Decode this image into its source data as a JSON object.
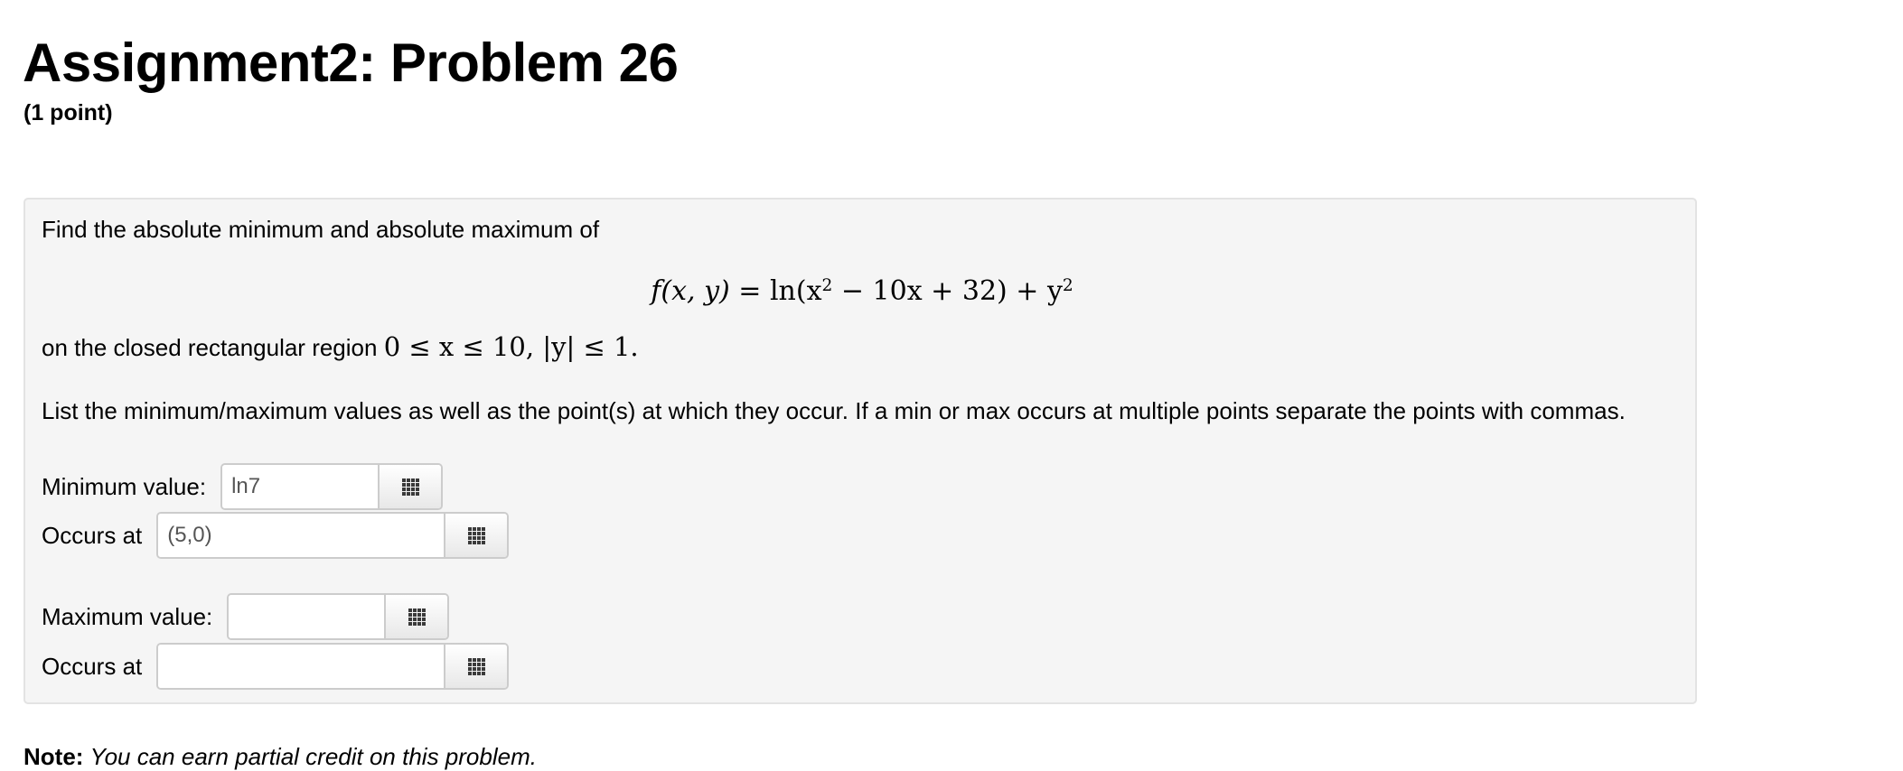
{
  "header": {
    "title": "Assignment2: Problem 26",
    "points": "(1 point)"
  },
  "problem": {
    "intro": "Find the absolute minimum and absolute maximum of",
    "formula": {
      "lhs": "f(x, y)",
      "rhs_parts": [
        "ln(x",
        "2",
        " − 10x + 32) + y",
        "2"
      ]
    },
    "region_text": "on the closed rectangular region",
    "region_math": "0 ≤ x ≤ 10, |y| ≤ 1.",
    "instructions": "List the minimum/maximum values as well as the point(s) at which they occur. If a min or max occurs at multiple points separate the points with commas.",
    "answers": [
      {
        "label": "Minimum value:",
        "value": "ln7"
      },
      {
        "label": "Occurs at",
        "value": "(5,0)"
      },
      {
        "label": "Maximum value:",
        "value": ""
      },
      {
        "label": "Occurs at",
        "value": ""
      }
    ],
    "equation_button_icon": "grid-icon"
  },
  "note": {
    "label": "Note:",
    "text": "You can earn partial credit on this problem."
  }
}
